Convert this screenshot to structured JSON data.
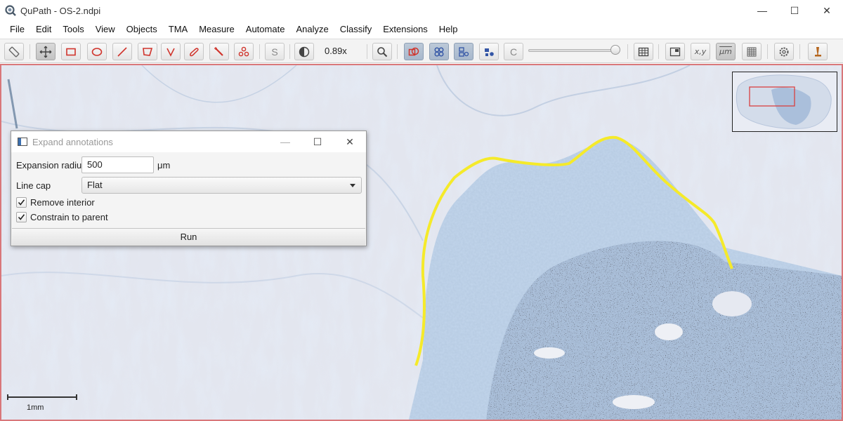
{
  "window": {
    "title": "QuPath - OS-2.ndpi",
    "controls": {
      "minimize": "—",
      "maximize": "☐",
      "close": "✕"
    }
  },
  "menu": [
    "File",
    "Edit",
    "Tools",
    "View",
    "Objects",
    "TMA",
    "Measure",
    "Automate",
    "Analyze",
    "Classify",
    "Extensions",
    "Help"
  ],
  "toolbar": {
    "zoom": "0.89x",
    "coords_label": "x,y",
    "micron_label": "μm",
    "brush_s": "S",
    "brush_c": "C",
    "opacity_slider_level": 0.95,
    "tool_icons": [
      "measure-icon",
      "move-icon",
      "rectangle-icon",
      "ellipse-icon",
      "line-icon",
      "polygon-icon",
      "polyline-icon",
      "brush-icon",
      "wand-icon",
      "points-icon",
      "selection-mode-icon",
      "brightness-contrast-icon",
      "zoom-to-fit-icon",
      "show-annotations-icon",
      "show-tma-grid-icon",
      "show-detections-icon",
      "fill-detections-icon",
      "measurement-table-icon",
      "overview-icon",
      "location-icon",
      "scalebar-icon",
      "grid-icon",
      "preferences-icon",
      "log-icon"
    ],
    "colors": {
      "annotation_tool": "#d0342c",
      "selected": "#a8b8cc"
    }
  },
  "viewer": {
    "annotation_color": "#f5ea2a",
    "border_color": "#d9777a",
    "scalebar_label": "1mm"
  },
  "dialog": {
    "title": "Expand annotations",
    "expansion_radius_label": "Expansion radius",
    "expansion_radius_value": "500",
    "expansion_radius_unit": "μm",
    "line_cap_label": "Line cap",
    "line_cap_value": "Flat",
    "remove_interior_label": "Remove interior",
    "remove_interior_checked": true,
    "constrain_to_parent_label": "Constrain to parent",
    "constrain_to_parent_checked": true,
    "run_label": "Run"
  }
}
